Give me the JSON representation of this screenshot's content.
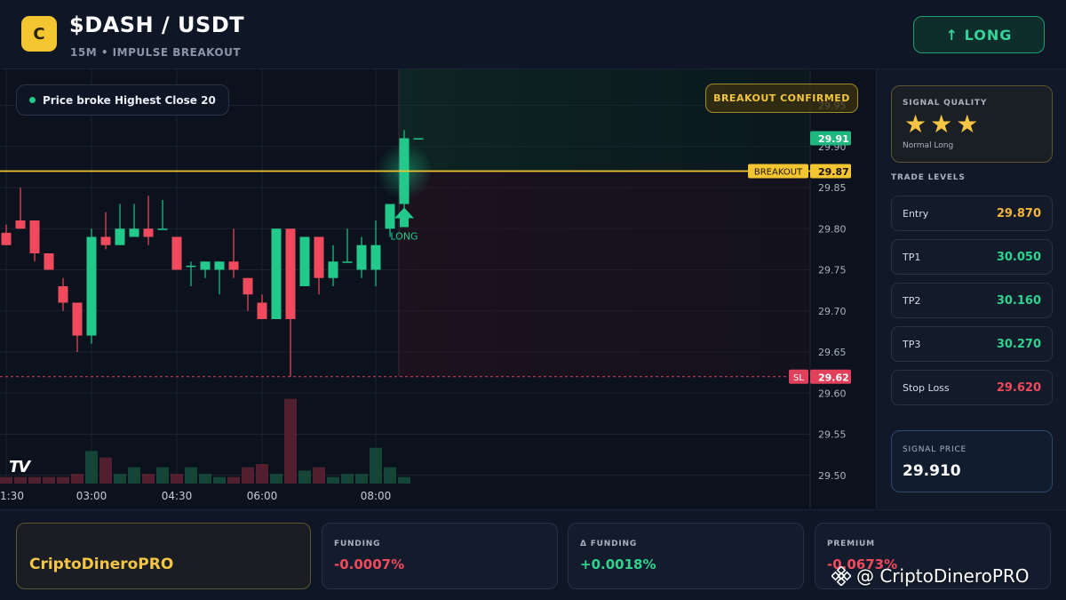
{
  "header": {
    "logo_letter": "C",
    "pair": "$DASH / USDT",
    "subtitle": "15M • IMPULSE BREAKOUT",
    "signal_button": "↑ LONG"
  },
  "chart": {
    "info_pill": "Price broke Highest Close 20",
    "confirm_badge": "BREAKOUT CONFIRMED",
    "breakout_label": "BREAKOUT",
    "breakout_value": "29.87",
    "current_value": "29.91",
    "sl_label": "SL",
    "sl_value": "29.62",
    "long_marker": "LONG",
    "tv_logo": "TV"
  },
  "chart_data": {
    "type": "candlestick",
    "ylim": [
      29.49,
      29.97
    ],
    "y_ticks": [
      "29.95",
      "29.90",
      "29.85",
      "29.80",
      "29.75",
      "29.70",
      "29.65",
      "29.60",
      "29.55",
      "29.50"
    ],
    "x_ticks": [
      {
        "label": "1:30",
        "index": 0
      },
      {
        "label": "03:00",
        "index": 6
      },
      {
        "label": "04:30",
        "index": 12
      },
      {
        "label": "06:00",
        "index": 18
      },
      {
        "label": "08:00",
        "index": 26
      }
    ],
    "breakout_level": 29.87,
    "stop_loss": 29.62,
    "candles": [
      {
        "o": 29.795,
        "h": 29.805,
        "l": 29.78,
        "c": 29.78
      },
      {
        "o": 29.81,
        "h": 29.85,
        "l": 29.8,
        "c": 29.8
      },
      {
        "o": 29.81,
        "h": 29.81,
        "l": 29.76,
        "c": 29.77
      },
      {
        "o": 29.77,
        "h": 29.77,
        "l": 29.75,
        "c": 29.75
      },
      {
        "o": 29.73,
        "h": 29.74,
        "l": 29.7,
        "c": 29.71
      },
      {
        "o": 29.71,
        "h": 29.71,
        "l": 29.65,
        "c": 29.67
      },
      {
        "o": 29.67,
        "h": 29.8,
        "l": 29.66,
        "c": 29.79
      },
      {
        "o": 29.79,
        "h": 29.82,
        "l": 29.775,
        "c": 29.78
      },
      {
        "o": 29.78,
        "h": 29.83,
        "l": 29.78,
        "c": 29.8
      },
      {
        "o": 29.79,
        "h": 29.83,
        "l": 29.79,
        "c": 29.8
      },
      {
        "o": 29.8,
        "h": 29.84,
        "l": 29.78,
        "c": 29.79
      },
      {
        "o": 29.8,
        "h": 29.835,
        "l": 29.8,
        "c": 29.8
      },
      {
        "o": 29.79,
        "h": 29.79,
        "l": 29.75,
        "c": 29.75
      },
      {
        "o": 29.755,
        "h": 29.76,
        "l": 29.73,
        "c": 29.755
      },
      {
        "o": 29.75,
        "h": 29.76,
        "l": 29.74,
        "c": 29.76
      },
      {
        "o": 29.75,
        "h": 29.76,
        "l": 29.72,
        "c": 29.76
      },
      {
        "o": 29.76,
        "h": 29.8,
        "l": 29.74,
        "c": 29.75
      },
      {
        "o": 29.74,
        "h": 29.74,
        "l": 29.7,
        "c": 29.72
      },
      {
        "o": 29.71,
        "h": 29.72,
        "l": 29.69,
        "c": 29.69
      },
      {
        "o": 29.69,
        "h": 29.8,
        "l": 29.69,
        "c": 29.8
      },
      {
        "o": 29.8,
        "h": 29.8,
        "l": 29.62,
        "c": 29.69
      },
      {
        "o": 29.73,
        "h": 29.79,
        "l": 29.73,
        "c": 29.79
      },
      {
        "o": 29.79,
        "h": 29.79,
        "l": 29.72,
        "c": 29.74
      },
      {
        "o": 29.74,
        "h": 29.78,
        "l": 29.73,
        "c": 29.76
      },
      {
        "o": 29.76,
        "h": 29.8,
        "l": 29.76,
        "c": 29.76
      },
      {
        "o": 29.75,
        "h": 29.79,
        "l": 29.74,
        "c": 29.78
      },
      {
        "o": 29.75,
        "h": 29.81,
        "l": 29.73,
        "c": 29.78
      },
      {
        "o": 29.8,
        "h": 29.83,
        "l": 29.79,
        "c": 29.83
      },
      {
        "o": 29.83,
        "h": 29.92,
        "l": 29.82,
        "c": 29.91
      },
      {
        "o": 29.91,
        "h": 29.91,
        "l": 29.91,
        "c": 29.91
      }
    ],
    "volumes": [
      2,
      2,
      2,
      2,
      2,
      3,
      10,
      8,
      3,
      5,
      3,
      5,
      3,
      5,
      3,
      2,
      2,
      5,
      6,
      3,
      26,
      4,
      5,
      2,
      3,
      3,
      11,
      5,
      2,
      0
    ],
    "volume_max": 30
  },
  "panel": {
    "signal_quality_title": "SIGNAL QUALITY",
    "stars": "★★★",
    "signal_quality_sub": "Normal Long",
    "trade_levels_title": "TRADE LEVELS",
    "levels": [
      {
        "label": "Entry",
        "value": "29.870",
        "color": "#f3b43a"
      },
      {
        "label": "TP1",
        "value": "30.050",
        "color": "#2fd38f"
      },
      {
        "label": "TP2",
        "value": "30.160",
        "color": "#2fd38f"
      },
      {
        "label": "TP3",
        "value": "30.270",
        "color": "#2fd38f"
      },
      {
        "label": "Stop Loss",
        "value": "29.620",
        "color": "#f04a5c"
      }
    ],
    "signal_price_label": "SIGNAL PRICE",
    "signal_price": "29.910"
  },
  "footer": {
    "brand": "CriptoDineroPRO",
    "stats": [
      {
        "label": "FUNDING",
        "value": "-0.0007%",
        "color": "#f04a5c"
      },
      {
        "label": "Δ FUNDING",
        "value": "+0.0018%",
        "color": "#2fd38f"
      },
      {
        "label": "PREMIUM",
        "value": "-0.0673%",
        "color": "#f04a5c"
      }
    ],
    "watermark": "@ CriptoDineroPRO"
  },
  "colors": {
    "up": "#22c98a",
    "down": "#f04a5c",
    "accent": "#f3c531"
  }
}
